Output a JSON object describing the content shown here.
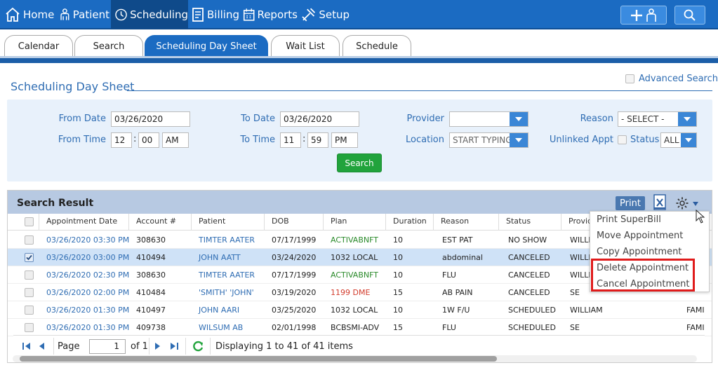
{
  "topnav": {
    "items": [
      {
        "label": "Home",
        "icon": "home-icon"
      },
      {
        "label": "Patient",
        "icon": "patient-icon"
      },
      {
        "label": "Scheduling",
        "icon": "clock-icon"
      },
      {
        "label": "Billing",
        "icon": "billing-icon"
      },
      {
        "label": "Reports",
        "icon": "calendar-icon"
      },
      {
        "label": "Setup",
        "icon": "tools-icon"
      }
    ],
    "active": "Scheduling"
  },
  "tabs": [
    "Calendar",
    "Search",
    "Scheduling Day Sheet",
    "Wait List",
    "Schedule"
  ],
  "active_tab": "Scheduling Day Sheet",
  "page": {
    "title": "Scheduling Day Sheet",
    "advanced_search": "Advanced Search"
  },
  "filters": {
    "from_date_label": "From Date",
    "from_date": "03/26/2020",
    "to_date_label": "To Date",
    "to_date": "03/26/2020",
    "from_time_label": "From Time",
    "from_hour": "12",
    "from_min": "00",
    "from_ampm": "AM",
    "to_time_label": "To Time",
    "to_hour": "11",
    "to_min": "59",
    "to_ampm": "PM",
    "provider_label": "Provider",
    "provider": "",
    "location_label": "Location",
    "location_placeholder": "START TYPING",
    "reason_label": "Reason",
    "reason": "- SELECT -",
    "unlinked_label": "Unlinked Appt",
    "status_label": "Status",
    "status": "ALL",
    "search_button": "Search"
  },
  "results": {
    "title": "Search Result",
    "print": "Print",
    "columns": [
      "Appointment Date",
      "Account #",
      "Patient",
      "DOB",
      "Plan",
      "Duration",
      "Reason",
      "Status",
      "Provid"
    ],
    "rows": [
      {
        "date": "03/26/2020 03:30 PM",
        "account": "308630",
        "patient": "TIMTER AATER",
        "dob": "07/17/1999",
        "plan": "ACTIVABNFT",
        "plan_color": "green",
        "duration": "10",
        "reason": "EST PAT",
        "status": "NO SHOW",
        "provider": "WILLI",
        "extra": "",
        "selected": false
      },
      {
        "date": "03/26/2020 03:00 PM",
        "account": "410494",
        "patient": "JOHN AATT",
        "dob": "03/24/2020",
        "plan": "1032 LOCAL",
        "plan_color": "black",
        "duration": "10",
        "reason": "abdominal",
        "status": "CANCELED",
        "provider": "WILLI",
        "extra": "",
        "selected": true
      },
      {
        "date": "03/26/2020 02:30 PM",
        "account": "308630",
        "patient": "TIMTER AATER",
        "dob": "07/17/1999",
        "plan": "ACTIVABNFT",
        "plan_color": "green",
        "duration": "10",
        "reason": "FLU",
        "status": "CANCELED",
        "provider": "WILLI",
        "extra": "",
        "selected": false
      },
      {
        "date": "03/26/2020 02:00 PM",
        "account": "410484",
        "patient": "'SMITH' 'JOHN'",
        "dob": "03/19/2020",
        "plan": "1199 DME",
        "plan_color": "red",
        "duration": "15",
        "reason": "AB PAIN",
        "status": "CANCELED",
        "provider": "SE",
        "extra": "",
        "selected": false
      },
      {
        "date": "03/26/2020 01:30 PM",
        "account": "410497",
        "patient": "JOHN AARI",
        "dob": "03/25/2020",
        "plan": "1032 LOCAL",
        "plan_color": "black",
        "duration": "10",
        "reason": "1W F/U",
        "status": "SCHEDULED",
        "provider": "WILLIAM",
        "extra": "FAMI",
        "selected": false
      },
      {
        "date": "03/26/2020 01:30 PM",
        "account": "409738",
        "patient": "WILSUM AB",
        "dob": "02/01/1998",
        "plan": "BCBSMI-ADV",
        "plan_color": "black",
        "duration": "15",
        "reason": "FLU",
        "status": "SCHEDULED",
        "provider": "SE",
        "extra": "FAMI",
        "selected": false
      }
    ]
  },
  "pager": {
    "page_label": "Page",
    "page": "1",
    "of_label": "of 1",
    "display": "Displaying 1 to 41 of 41 items"
  },
  "context_menu": {
    "items": [
      "Print SuperBill",
      "Move Appointment",
      "Copy Appointment",
      "Delete Appointment",
      "Cancel Appointment"
    ]
  },
  "colors": {
    "nav_blue": "#1b6bc2",
    "link_blue": "#2f6db3",
    "search_green": "#21a33c",
    "highlight_red": "#e01b1b"
  }
}
